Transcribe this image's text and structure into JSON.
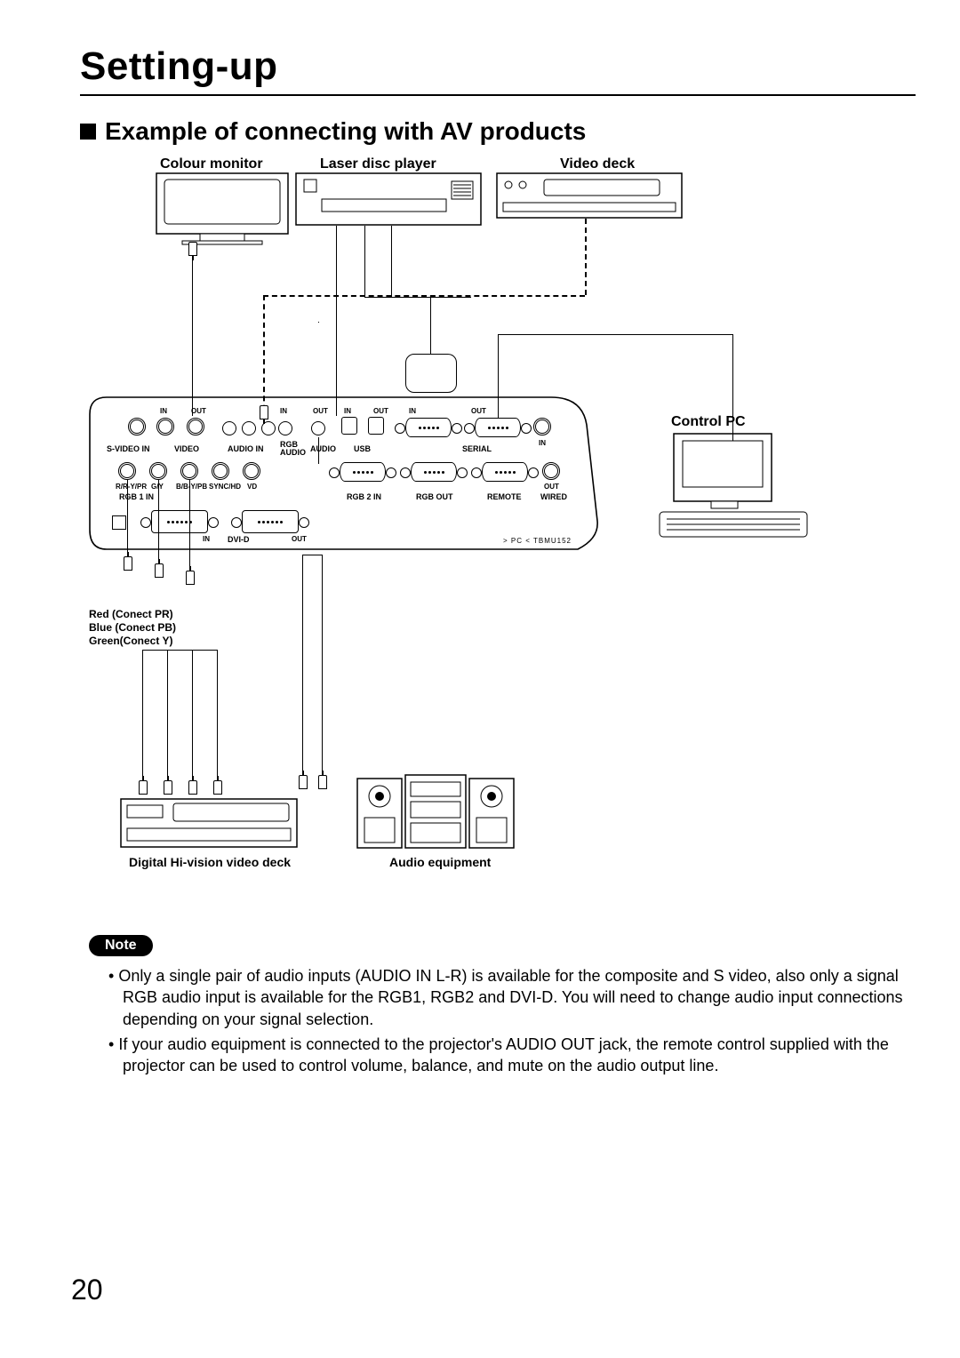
{
  "page_number": "20",
  "title": "Setting-up",
  "section_heading": "Example of connecting with AV products",
  "devices": {
    "colour_monitor": "Colour monitor",
    "laser_disc": "Laser disc player",
    "video_deck": "Video deck",
    "control_pc": "Control PC",
    "digital_hivision": "Digital Hi-vision video deck",
    "audio_equipment": "Audio equipment"
  },
  "rgb_note": {
    "r": "Red (Conect PR)",
    "b": "Blue (Conect PB)",
    "g": "Green(Conect Y)"
  },
  "panel": {
    "top_row": {
      "svideo_in_label": "S-VIDEO IN",
      "svideo_in": "IN",
      "svideo_out": "OUT",
      "video_label": "VIDEO",
      "audio_in_label": "AUDIO IN",
      "rgb_audio_label": "RGB\nAUDIO",
      "audio_label": "AUDIO",
      "audio_in_small": "IN",
      "audio_out_small": "OUT",
      "usb_in": "IN",
      "usb_out": "OUT",
      "usb_label": "USB",
      "serial_in": "IN",
      "serial_out": "OUT",
      "serial_label": "SERIAL",
      "in_right": "IN"
    },
    "mid_row": {
      "rgb1_r": "R/R-Y/PR",
      "rgb1_g": "G/Y",
      "rgb1_b": "B/B-Y/PB",
      "rgb1_sync": "SYNC/HD",
      "rgb1_vd": "VD",
      "rgb1_in_label": "RGB 1 IN",
      "rgb2_in_label": "RGB 2 IN",
      "rgb_out_label": "RGB OUT",
      "remote_label": "REMOTE",
      "wired_label": "WIRED",
      "out_small": "OUT"
    },
    "bottom_row": {
      "dvid_label": "DVI-D",
      "dvid_in": "IN",
      "dvid_out": "OUT",
      "footer_right": "> PC <    TBMU152"
    }
  },
  "note_label": "Note",
  "notes": [
    "Only a single pair of audio inputs (AUDIO IN L-R) is available for the composite and S video, also only a signal RGB audio input is available for the RGB1, RGB2 and DVI-D. You will need to change audio input connections depending on your signal selection.",
    "If your audio equipment is connected to the projector's AUDIO OUT jack, the remote control supplied with the projector can be used to control volume, balance, and mute on the audio output line."
  ]
}
